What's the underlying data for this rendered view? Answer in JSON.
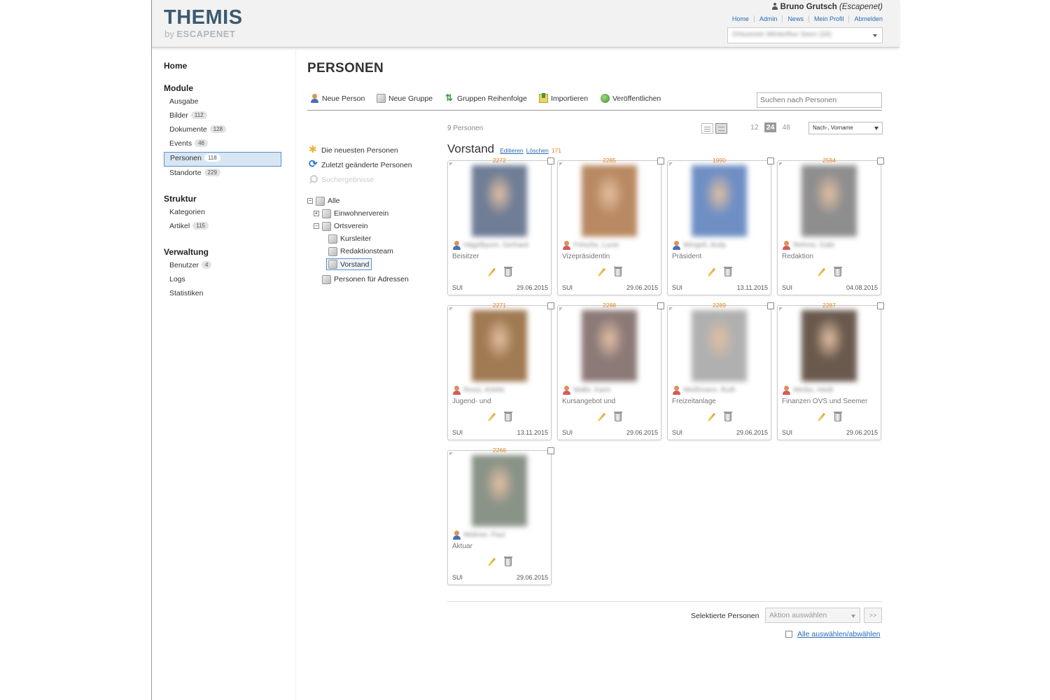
{
  "header": {
    "logo_main": "THEMIS",
    "logo_by": "by",
    "logo_brand": "ESCAPENET",
    "user_name": "Bruno Grutsch",
    "user_org": "(Escapenet)",
    "nav": [
      "Home",
      "Admin",
      "News",
      "Mein Profil",
      "Abmelden"
    ],
    "org_select_value": "Ortsverein Winterthur Seen (34)"
  },
  "sidebar": {
    "home": "Home",
    "sections": [
      {
        "title": "Module",
        "items": [
          {
            "label": "Ausgabe",
            "badge": ""
          },
          {
            "label": "Bilder",
            "badge": "112"
          },
          {
            "label": "Dokumente",
            "badge": "128"
          },
          {
            "label": "Events",
            "badge": "46"
          },
          {
            "label": "Personen",
            "badge": "118"
          },
          {
            "label": "Standorte",
            "badge": "229"
          }
        ]
      },
      {
        "title": "Struktur",
        "items": [
          {
            "label": "Kategorien",
            "badge": ""
          },
          {
            "label": "Artikel",
            "badge": "115"
          }
        ]
      },
      {
        "title": "Verwaltung",
        "items": [
          {
            "label": "Benutzer",
            "badge": "4"
          },
          {
            "label": "Logs",
            "badge": ""
          },
          {
            "label": "Statistiken",
            "badge": ""
          }
        ]
      }
    ]
  },
  "page": {
    "title": "PERSONEN",
    "toolbar": {
      "new_person": "Neue Person",
      "new_group": "Neue Gruppe",
      "group_order": "Gruppen Reihenfolge",
      "import": "Importieren",
      "publish": "Veröffentlichen",
      "search_placeholder": "Suchen nach Personen"
    },
    "left_links": {
      "newest": "Die neuesten Personen",
      "recently_changed": "Zuletzt geänderte Personen",
      "search_results": "Suchergebnisse"
    },
    "tree": {
      "all": "Alle",
      "einwohnerverein": "Einwohnerverein",
      "ortsverein": "Ortsverein",
      "kursleiter": "Kursleiter",
      "redaktionsteam": "Redaktionsteam",
      "vorstand": "Vorstand",
      "personen_adressen": "Personen für Adressen"
    },
    "count_text": "9 Personen",
    "pager": [
      "12",
      "24",
      "48"
    ],
    "pager_active": "24",
    "sort_value": "Nach-, Vorname",
    "group": {
      "name": "Vorstand",
      "edit": "Editieren",
      "delete": "Löschen",
      "id": "171"
    },
    "persons": [
      {
        "id": "2272",
        "name": "Hägelbyom, Gerhard",
        "role": "Beisitzer",
        "country": "SUI",
        "date": "29.06.2015",
        "gender": "male",
        "photo": "#6f7d96"
      },
      {
        "id": "2285",
        "name": "Fritsche, Lucie",
        "role": "Vizepräsidentin",
        "country": "SUI",
        "date": "29.06.2015",
        "gender": "female",
        "photo": "#b98a62"
      },
      {
        "id": "1990",
        "name": "Wingelt, Andy",
        "role": "Präsident",
        "country": "SUI",
        "date": "13.11.2015",
        "gender": "male",
        "photo": "#6f8fc4"
      },
      {
        "id": "2584",
        "name": "Rehme, Gabi",
        "role": "Redaktion",
        "country": "SUI",
        "date": "04.08.2015",
        "gender": "female",
        "photo": "#8e8e8e"
      },
      {
        "id": "2271",
        "name": "Rossi, Arlette",
        "role": "Jugend- und",
        "country": "SUI",
        "date": "13.11.2015",
        "gender": "female",
        "photo": "#a07a52"
      },
      {
        "id": "2288",
        "name": "Walle, Karin",
        "role": "Kursangebot und",
        "country": "SUI",
        "date": "29.06.2015",
        "gender": "female",
        "photo": "#8c7a78"
      },
      {
        "id": "2289",
        "name": "Weißmann, Ruth",
        "role": "Freizeitanlage",
        "country": "SUI",
        "date": "29.06.2015",
        "gender": "female",
        "photo": "#b0b0b0"
      },
      {
        "id": "2287",
        "name": "Werke, Heidi",
        "role": "Finanzen OVS und Seemer",
        "country": "SUI",
        "date": "29.06.2015",
        "gender": "female",
        "photo": "#6a5a4e"
      },
      {
        "id": "2266",
        "name": "Widmer, Paul",
        "role": "Aktuar",
        "country": "SUI",
        "date": "29.06.2015",
        "gender": "male",
        "photo": "#8a9388"
      }
    ],
    "bottom": {
      "selected_label": "Selektierte Personen",
      "action_placeholder": "Aktion auswählen",
      "go": ">>",
      "select_all": "Alle auswählen/abwählen"
    }
  }
}
